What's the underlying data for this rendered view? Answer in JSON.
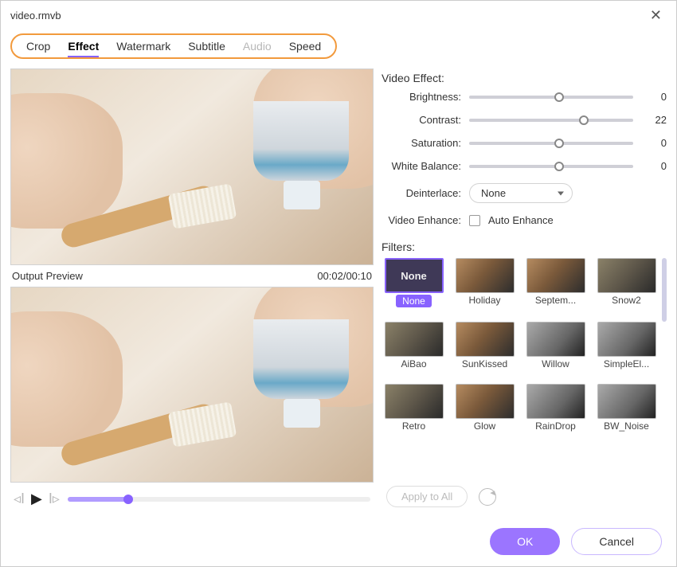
{
  "window": {
    "title": "video.rmvb"
  },
  "tabs": {
    "crop": "Crop",
    "effect": "Effect",
    "watermark": "Watermark",
    "subtitle": "Subtitle",
    "audio": "Audio",
    "speed": "Speed"
  },
  "preview": {
    "output_label": "Output Preview",
    "timecode": "00:02/00:10",
    "scrub_percent": 20
  },
  "effect": {
    "section": "Video Effect:",
    "brightness": {
      "label": "Brightness:",
      "value": "0",
      "percent": 55
    },
    "contrast": {
      "label": "Contrast:",
      "value": "22",
      "percent": 70
    },
    "saturation": {
      "label": "Saturation:",
      "value": "0",
      "percent": 55
    },
    "white_balance": {
      "label": "White Balance:",
      "value": "0",
      "percent": 55
    },
    "deinterlace": {
      "label": "Deinterlace:",
      "value": "None"
    },
    "enhance": {
      "label": "Video Enhance:",
      "checkbox_label": "Auto Enhance",
      "checked": false
    }
  },
  "filters": {
    "section": "Filters:",
    "apply_all": "Apply to All",
    "items": [
      {
        "name": "None",
        "selected": true,
        "style": "none"
      },
      {
        "name": "Holiday",
        "style": "img"
      },
      {
        "name": "Septem...",
        "style": "img"
      },
      {
        "name": "Snow2",
        "style": "img2"
      },
      {
        "name": "AiBao",
        "style": "img2"
      },
      {
        "name": "SunKissed",
        "style": "img"
      },
      {
        "name": "Willow",
        "style": "img3"
      },
      {
        "name": "SimpleEl...",
        "style": "img3"
      },
      {
        "name": "Retro",
        "style": "img2"
      },
      {
        "name": "Glow",
        "style": "img"
      },
      {
        "name": "RainDrop",
        "style": "img3"
      },
      {
        "name": "BW_Noise",
        "style": "img3"
      }
    ]
  },
  "footer": {
    "ok": "OK",
    "cancel": "Cancel"
  }
}
